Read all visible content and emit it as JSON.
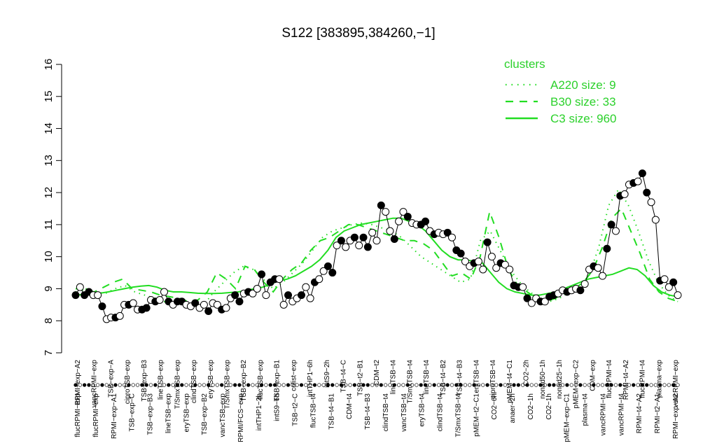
{
  "chart_data": {
    "type": "line",
    "title": "S122 [383895,384260,−1]",
    "xlabel": "",
    "ylabel": "",
    "ylim": [
      7,
      16
    ],
    "y_ticks": [
      7,
      8,
      9,
      10,
      11,
      12,
      13,
      14,
      15,
      16
    ],
    "grid": false,
    "legend_position": "top-right",
    "legend": {
      "title": "clusters",
      "entries": [
        {
          "label": "A220 size: 9",
          "style": "dotted"
        },
        {
          "label": "B30 size: 33",
          "style": "dashed"
        },
        {
          "label": "C3 size: 960",
          "style": "solid"
        }
      ]
    },
    "colors": {
      "cluster_lines": "#22dd22",
      "points": "#000000",
      "open_fill": "#ffffff"
    },
    "top_labels": [
      "RPMI−exp−A2",
      "vancRPMI−exp",
      "TSB−exp−A",
      "ciproTSB−exp",
      "TSB−exp−B3",
      "lineTSB−exp",
      "T/SmxTSB−exp",
      "clindTSB−exp",
      "eryTSB−exp",
      "T/SmxTSB−exp",
      "TSB−exp−B2",
      "flucTSB−exp",
      "TSB−exp−B1",
      "colist−exp",
      "intTHP1−6h",
      "intS9−2h",
      "TSB−t4−C",
      "TSB−t2−B1",
      "CDM−t2",
      "lineTSB−t4",
      "T/SmxTSB−t4",
      "lineTSB−t4",
      "TSB−t4−B2",
      "TSB−t4−B3",
      "eryTSB−t4",
      "ciproTSB−t4",
      "pMEM−t4−C1",
      "CO2−2h",
      "nonad50−1h",
      "nonad25−1h",
      "pMEM−exp−C2",
      "CDM−exp",
      "flucRPMI−t4",
      "RPMI−t4−A2",
      "flucRPMI−t4",
      "plasma−exp",
      "vancRPMI−exp"
    ],
    "bottom_labels": [
      "flucRPMI−exp",
      "flucRPMI−exp",
      "RPMI−exp−A1",
      "TSB−exp−C",
      "TSB−exp−B3",
      "lineTSB−exp",
      "eryTSB−exp",
      "TSB−exp−B2",
      "vancTSB−exp",
      "RPMI/FCS−exp",
      "intTHP1−2h",
      "intS9−6h",
      "TSB−t2−C",
      "flucTSB−t4",
      "TSB−t4−B1",
      "CDM−t4",
      "TSB−t4−B3",
      "clindTSB−t4",
      "vancTSB−t4",
      "eryTSB−t4",
      "clindTSB−t4",
      "T/SmxTSB−t4",
      "pMEM−t2−C1",
      "CO2−6h",
      "anaer−2h",
      "CO2−1h",
      "CO2−1h",
      "pMEM−exp−C1",
      "plasma−t4",
      "vancRPMI−t4",
      "vancRPMI−t4",
      "RPMI−t4−A2",
      "RPMI−t2−A1",
      "RPMI−exp−A2"
    ],
    "series": [
      {
        "label": "C3 size: 960",
        "style": "solid",
        "values": [
          8.8,
          8.82,
          8.84,
          8.86,
          8.9,
          8.95,
          9.0,
          9.05,
          9.08,
          9.1,
          9.05,
          8.95,
          8.9,
          8.9,
          8.88,
          8.86,
          8.85,
          8.85,
          8.86,
          8.88,
          8.9,
          8.95,
          9.0,
          9.05,
          9.15,
          9.25,
          9.3,
          9.4,
          9.55,
          9.7,
          9.9,
          10.2,
          10.6,
          10.8,
          10.9,
          11.0,
          11.05,
          11.1,
          11.15,
          11.2,
          11.2,
          11.1,
          11.0,
          10.8,
          10.5,
          10.2,
          10.0,
          9.9,
          9.9,
          9.85,
          9.8,
          9.5,
          9.2,
          9.0,
          8.9,
          8.85,
          8.8,
          8.8,
          8.85,
          8.9,
          9.0,
          9.1,
          9.2,
          9.3,
          9.35,
          9.4,
          9.45,
          9.55,
          9.65,
          9.6,
          9.4,
          9.1,
          8.9,
          8.8,
          8.75
        ]
      },
      {
        "label": "B30 size: 33",
        "style": "dashed",
        "values": [
          9.0,
          8.95,
          8.9,
          9.05,
          9.2,
          9.3,
          9.0,
          8.95,
          8.9,
          8.8,
          8.75,
          8.7,
          8.6,
          8.65,
          8.9,
          9.5,
          9.3,
          9.0,
          9.7,
          9.6,
          9.2,
          8.9,
          9.3,
          9.6,
          9.8,
          10.2,
          10.5,
          10.6,
          10.8,
          11.0,
          11.0,
          10.9,
          10.8,
          10.7,
          10.6,
          10.5,
          10.5,
          10.4,
          10.2,
          9.8,
          9.4,
          9.5,
          9.3,
          10.0,
          11.4,
          10.6,
          9.6,
          9.1,
          8.9,
          8.7,
          8.6,
          8.7,
          8.9,
          9.0,
          9.2,
          9.6,
          10.3,
          11.2,
          11.5,
          10.8,
          10.1,
          9.3,
          8.9,
          8.7,
          8.6
        ]
      },
      {
        "label": "A220 size: 9",
        "style": "dotted",
        "values": [
          8.9,
          9.0,
          8.9,
          8.85,
          9.0,
          9.1,
          8.9,
          8.8,
          8.7,
          8.6,
          8.55,
          8.5,
          8.5,
          8.5,
          8.9,
          9.2,
          9.5,
          9.7,
          9.6,
          9.3,
          9.0,
          9.2,
          9.5,
          9.8,
          10.2,
          10.6,
          10.8,
          10.9,
          11.0,
          11.05,
          11.0,
          10.9,
          10.8,
          10.6,
          10.3,
          10.0,
          9.8,
          9.6,
          9.4,
          9.2,
          9.3,
          10.5,
          10.8,
          10.2,
          9.6,
          9.2,
          8.9,
          8.7,
          8.6,
          8.7,
          8.9,
          9.1,
          9.4,
          10.3,
          11.6,
          12.1,
          11.6,
          10.8,
          9.9,
          9.2,
          8.8,
          8.6
        ]
      },
      {
        "label": "samples",
        "style": "points",
        "values": [
          8.8,
          9.05,
          8.8,
          8.9,
          8.8,
          8.8,
          8.45,
          8.05,
          8.1,
          8.1,
          8.15,
          8.5,
          8.5,
          8.55,
          8.35,
          8.35,
          8.4,
          8.65,
          8.6,
          8.65,
          8.9,
          8.6,
          8.5,
          8.6,
          8.6,
          8.5,
          8.45,
          8.55,
          8.4,
          8.5,
          8.3,
          8.55,
          8.5,
          8.35,
          8.4,
          8.7,
          8.8,
          8.6,
          8.85,
          8.9,
          8.85,
          9.0,
          9.45,
          8.8,
          9.2,
          9.3,
          9.3,
          8.5,
          8.8,
          8.6,
          8.7,
          8.8,
          9.05,
          8.7,
          9.2,
          9.3,
          9.55,
          9.7,
          9.5,
          10.35,
          10.5,
          10.3,
          10.5,
          10.6,
          10.35,
          10.6,
          10.3,
          10.75,
          10.5,
          11.6,
          11.4,
          10.8,
          10.55,
          11.1,
          11.4,
          11.25,
          11.05,
          11.0,
          11.0,
          11.1,
          10.8,
          10.7,
          10.75,
          10.7,
          10.75,
          10.6,
          10.2,
          10.1,
          9.85,
          9.7,
          9.8,
          9.85,
          9.6,
          10.45,
          10.0,
          9.65,
          9.8,
          9.75,
          9.6,
          9.1,
          9.05,
          9.05,
          8.7,
          8.55,
          8.7,
          8.6,
          8.6,
          8.75,
          8.8,
          8.85,
          8.95,
          8.9,
          8.95,
          9.0,
          8.95,
          9.15,
          9.6,
          9.7,
          9.65,
          9.4,
          10.25,
          11.0,
          10.8,
          11.9,
          11.95,
          12.25,
          12.3,
          12.35,
          12.6,
          12.0,
          11.7,
          11.15,
          9.25,
          9.3,
          9.05,
          9.2,
          8.8
        ]
      }
    ]
  }
}
